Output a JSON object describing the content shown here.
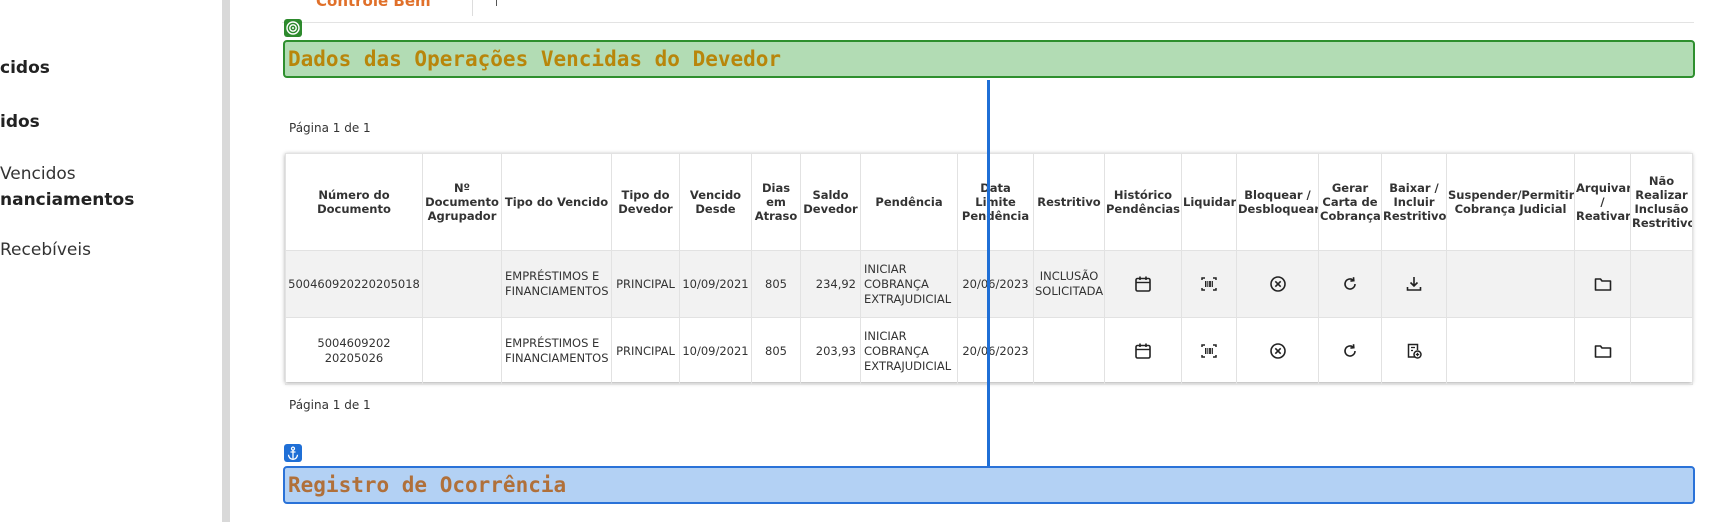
{
  "sidebar": {
    "items": [
      {
        "label": "cidos"
      },
      {
        "label": "idos"
      },
      {
        "label": "Vencidos"
      },
      {
        "label": "nanciamentos"
      },
      {
        "label": "Recebíveis"
      }
    ]
  },
  "top_tab": {
    "label": "Controle Bem"
  },
  "section_overdue": {
    "title": "Dados das Operações Vencidas do Devedor"
  },
  "section_register": {
    "title": "Registro de Ocorrência"
  },
  "pagination": {
    "top": "Página 1 de 1",
    "bottom": "Página 1 de 1"
  },
  "table": {
    "headers": [
      "Número do Documento",
      "Nº Documento Agrupador",
      "Tipo do Vencido",
      "Tipo do Devedor",
      "Vencido Desde",
      "Dias em Atraso",
      "Saldo Devedor",
      "Pendência",
      "Data Limite Pendência",
      "Restritivo",
      "Histórico Pendências",
      "Liquidar",
      "Bloquear / Desbloquear",
      "Gerar Carta de Cobrança",
      "Baixar / Incluir Restritivo",
      "Suspender/Permitir Cobrança Judicial",
      "Arquivar / Reativar",
      "Não Realizar Inclusão Restritivo"
    ],
    "rows": [
      {
        "numero": "500460920220205018",
        "agrupador": "",
        "tipo_vencido": "EMPRÉSTIMOS E FINANCIAMENTOS",
        "tipo_devedor": "PRINCIPAL",
        "vencido_desde": "10/09/2021",
        "dias_atraso": "805",
        "saldo": "234,92",
        "pendencia": "INICIAR COBRANÇA EXTRAJUDICIAL",
        "data_limite": "20/06/2023",
        "restritivo": "INCLUSÃO SOLICITADA",
        "restritivo_action_icon": "download-icon"
      },
      {
        "numero": "5004609202 20205026",
        "agrupador": "",
        "tipo_vencido": "EMPRÉSTIMOS E FINANCIAMENTOS",
        "tipo_devedor": "PRINCIPAL",
        "vencido_desde": "10/09/2021",
        "dias_atraso": "805",
        "saldo": "203,93",
        "pendencia": "INICIAR COBRANÇA EXTRAJUDICIAL",
        "data_limite": "20/06/2023",
        "restritivo": "",
        "restritivo_action_icon": "add-restriction-icon"
      }
    ]
  },
  "colors": {
    "green_bar": "#b2dcb4",
    "green_border": "#2e8f2e",
    "green_title": "#b8860b",
    "blue_bar": "#b3d1f4",
    "blue_border": "#2a72d8",
    "blue_title": "#b0703a",
    "accent_orange": "#e0702a"
  }
}
